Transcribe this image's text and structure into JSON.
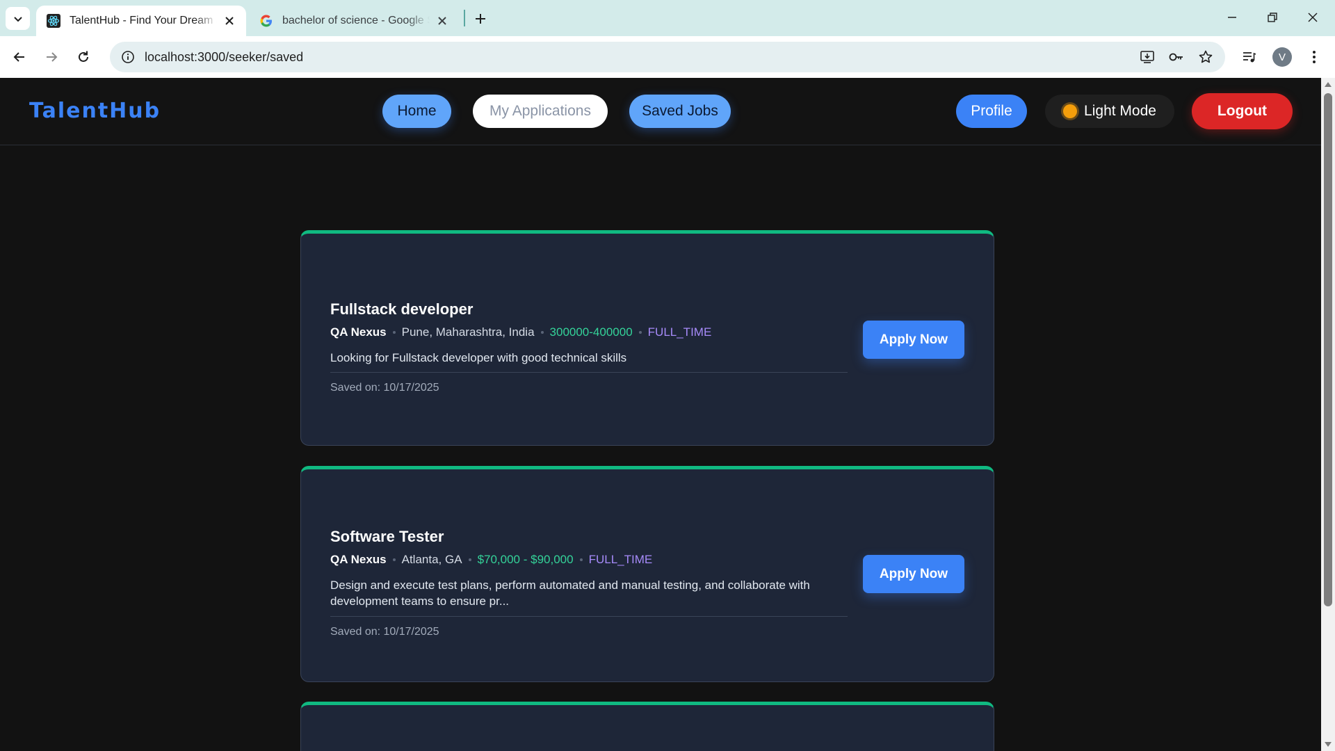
{
  "browser": {
    "tabs": [
      {
        "title": "TalentHub - Find Your Dream Job",
        "active": true
      },
      {
        "title": "bachelor of science - Google Search",
        "active": false
      }
    ],
    "url": "localhost:3000/seeker/saved",
    "profile_initial": "V"
  },
  "app": {
    "brand": "TalentHub",
    "nav": {
      "home": "Home",
      "applications": "My Applications",
      "saved": "Saved Jobs",
      "profile": "Profile",
      "mode": "Light Mode",
      "logout": "Logout"
    }
  },
  "saved_jobs": [
    {
      "title": "Fullstack developer",
      "company": "QA Nexus",
      "location": "Pune, Maharashtra, India",
      "salary": "300000-400000",
      "type": "FULL_TIME",
      "description": "Looking for Fullstack developer with good technical skills",
      "saved_on": "Saved on: 10/17/2025",
      "apply_label": "Apply Now"
    },
    {
      "title": "Software Tester",
      "company": "QA Nexus",
      "location": "Atlanta, GA",
      "salary": "$70,000 - $90,000",
      "type": "FULL_TIME",
      "description": "Design and execute test plans, perform automated and manual testing, and collaborate with development teams to ensure pr...",
      "saved_on": "Saved on: 10/17/2025",
      "apply_label": "Apply Now"
    }
  ],
  "colors": {
    "brand": "#3b82f6",
    "accent_bar": "#10b981",
    "salary": "#34d399",
    "job_type": "#a78bfa",
    "logout": "#dc2626"
  }
}
